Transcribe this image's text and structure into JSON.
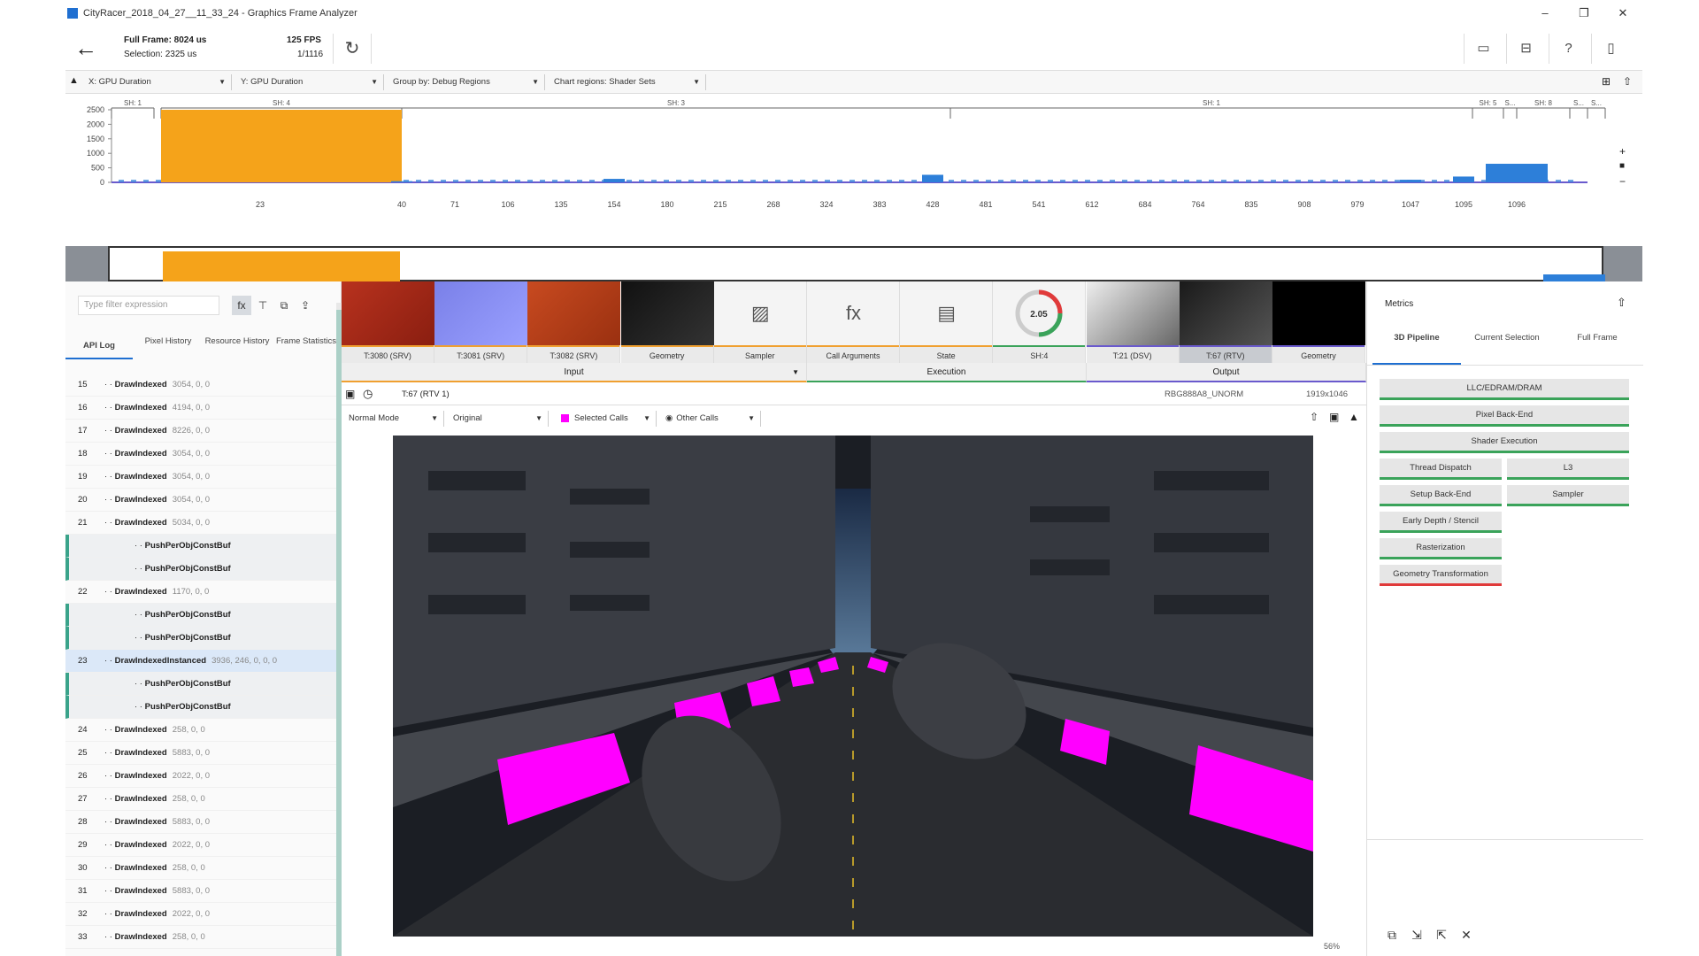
{
  "window": {
    "title": "CityRacer_2018_04_27__11_33_24 - Graphics Frame Analyzer",
    "controls": [
      "–",
      "❐",
      "✕"
    ]
  },
  "header": {
    "back_icon": "arrow-left-icon",
    "full_frame_label": "Full Frame: 8024 us",
    "selection_label": "Selection: 2325 us",
    "fps": "125 FPS",
    "count": "1/1116",
    "buttons": [
      "▭",
      "⊟",
      "?",
      "▯"
    ]
  },
  "toolbar": {
    "x_axis": "X: GPU Duration",
    "y_axis": "Y: GPU Duration",
    "group_by": "Group by: Debug Regions",
    "chart_regions": "Chart regions: Shader Sets"
  },
  "chart_data": {
    "type": "bar",
    "ylim": [
      0,
      2500
    ],
    "yticks": [
      "2500",
      "2000",
      "1500",
      "1000",
      "500",
      "0"
    ],
    "regions": [
      "SH: 1",
      "SH: 4",
      "SH: 3",
      "SH: 1",
      "SH: 5",
      "S...",
      "SH: 8",
      "S...",
      "S..."
    ],
    "xticks": [
      "23",
      "40",
      "71",
      "106",
      "135",
      "154",
      "180",
      "215",
      "268",
      "324",
      "383",
      "428",
      "481",
      "541",
      "612",
      "684",
      "764",
      "835",
      "908",
      "979",
      "1047",
      "1095",
      "1096"
    ],
    "highlight": {
      "label": "23",
      "value": 2500,
      "color": "#f5a31a"
    },
    "bar_color": "#2d7fd9",
    "bars": [
      {
        "x": "23",
        "value": 2500
      },
      {
        "x": "40",
        "value": 40
      },
      {
        "x": "154",
        "value": 120
      },
      {
        "x": "428",
        "value": 260
      },
      {
        "x": "1047",
        "value": 90
      },
      {
        "x": "1095",
        "value": 200
      },
      {
        "x": "1096",
        "value": 640
      }
    ]
  },
  "left_panel": {
    "filter_placeholder": "Type filter expression",
    "filter_buttons": [
      "fx",
      "⊤",
      "⧉",
      "⇪"
    ],
    "tabs": [
      "API Log",
      "Pixel History",
      "Resource History",
      "Frame Statistics"
    ],
    "rows": [
      {
        "n": "15",
        "name": "DrawIndexed",
        "args": "3054, 0, 0"
      },
      {
        "n": "16",
        "name": "DrawIndexed",
        "args": "4194, 0, 0"
      },
      {
        "n": "17",
        "name": "DrawIndexed",
        "args": "8226, 0, 0"
      },
      {
        "n": "18",
        "name": "DrawIndexed",
        "args": "3054, 0, 0"
      },
      {
        "n": "19",
        "name": "DrawIndexed",
        "args": "3054, 0, 0"
      },
      {
        "n": "20",
        "name": "DrawIndexed",
        "args": "3054, 0, 0"
      },
      {
        "n": "21",
        "name": "DrawIndexed",
        "args": "5034, 0, 0"
      },
      {
        "n": "",
        "name": "PushPerObjConstBuf",
        "args": ""
      },
      {
        "n": "",
        "name": "PushPerObjConstBuf",
        "args": ""
      },
      {
        "n": "22",
        "name": "DrawIndexed",
        "args": "1170, 0, 0"
      },
      {
        "n": "",
        "name": "PushPerObjConstBuf",
        "args": ""
      },
      {
        "n": "",
        "name": "PushPerObjConstBuf",
        "args": ""
      },
      {
        "n": "23",
        "name": "DrawIndexedInstanced",
        "args": "3936, 246, 0, 0, 0"
      },
      {
        "n": "",
        "name": "PushPerObjConstBuf",
        "args": ""
      },
      {
        "n": "",
        "name": "PushPerObjConstBuf",
        "args": ""
      },
      {
        "n": "24",
        "name": "DrawIndexed",
        "args": "258, 0, 0"
      },
      {
        "n": "25",
        "name": "DrawIndexed",
        "args": "5883, 0, 0"
      },
      {
        "n": "26",
        "name": "DrawIndexed",
        "args": "2022, 0, 0"
      },
      {
        "n": "27",
        "name": "DrawIndexed",
        "args": "258, 0, 0"
      },
      {
        "n": "28",
        "name": "DrawIndexed",
        "args": "5883, 0, 0"
      },
      {
        "n": "29",
        "name": "DrawIndexed",
        "args": "2022, 0, 0"
      },
      {
        "n": "30",
        "name": "DrawIndexed",
        "args": "258, 0, 0"
      },
      {
        "n": "31",
        "name": "DrawIndexed",
        "args": "5883, 0, 0"
      },
      {
        "n": "32",
        "name": "DrawIndexed",
        "args": "2022, 0, 0"
      },
      {
        "n": "33",
        "name": "DrawIndexed",
        "args": "258, 0, 0"
      }
    ]
  },
  "center": {
    "resources": [
      {
        "label": "T:3080 (SRV)",
        "icon": "texture-red"
      },
      {
        "label": "T:3081 (SRV)",
        "icon": "texture-normal"
      },
      {
        "label": "T:3082 (SRV)",
        "icon": "texture-orange"
      },
      {
        "label": "Geometry",
        "icon": "geometry-thumb"
      },
      {
        "label": "Sampler",
        "icon": "image-icon"
      },
      {
        "label": "Call Arguments",
        "icon": "fx-icon"
      },
      {
        "label": "State",
        "icon": "document-icon"
      },
      {
        "label": "SH:4",
        "icon": "gauge"
      },
      {
        "label": "T:21 (DSV)",
        "icon": "depth-thumb"
      },
      {
        "label": "T:67 (RTV)",
        "icon": "render-thumb"
      },
      {
        "label": "Geometry",
        "icon": "geometry-dark"
      }
    ],
    "gauge_value": "2.05",
    "groups": [
      "Input",
      "Execution",
      "Output"
    ],
    "view_title": "T:67 (RTV 1)",
    "format": "RBG888A8_UNORM",
    "resolution": "1919x1046",
    "mode": "Normal Mode",
    "channel": "Original",
    "selected_calls": "Selected Calls",
    "other_calls": "Other Calls",
    "zoom": "56%",
    "highlight_color": "#ff00ff"
  },
  "right_panel": {
    "title": "Metrics",
    "tabs": [
      "3D Pipeline",
      "Current Selection",
      "Full Frame"
    ],
    "metrics": [
      "LLC/EDRAM/DRAM",
      "Pixel Back-End",
      "Shader Execution",
      "Thread Dispatch",
      "L3",
      "Setup Back-End",
      "Sampler",
      "Early Depth / Stencil",
      "Rasterization",
      "Geometry Transformation"
    ],
    "tools": [
      "⧉",
      "⇲",
      "⇱",
      "✕"
    ]
  }
}
